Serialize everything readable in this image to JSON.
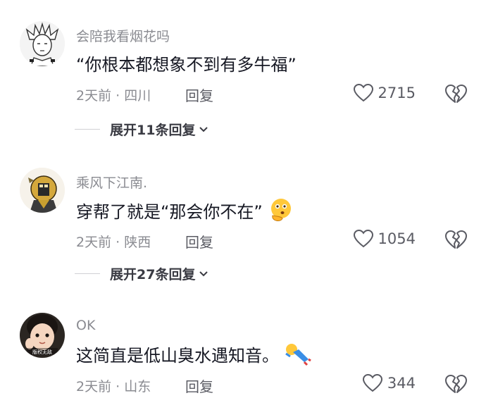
{
  "comments": [
    {
      "username": "会陪我看烟花吗",
      "text": "“你根本都想象不到有多牛福”",
      "meta": "2天前 · 四川",
      "reply_label": "回复",
      "likes": "2715",
      "expand_label": "展开11条回复"
    },
    {
      "username": "乘风下江南.",
      "text": "穿帮了就是“那会你不在”",
      "meta": "2天前 · 陕西",
      "reply_label": "回复",
      "likes": "1054",
      "expand_label": "展开27条回复"
    },
    {
      "username": "OK",
      "text": "这简直是低山臭水遇知音。",
      "meta": "2天前 · 山东",
      "reply_label": "回复",
      "likes": "344",
      "avatar_caption": "版权无敌"
    }
  ]
}
